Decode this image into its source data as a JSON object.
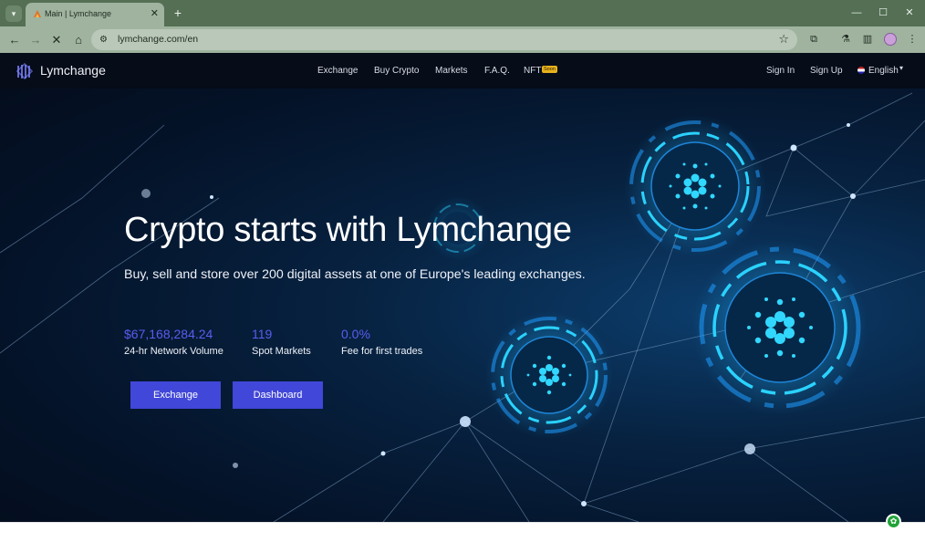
{
  "browser": {
    "tab_title": "Main | Lymchange",
    "url": "lymchange.com/en"
  },
  "site": {
    "brand": "Lymchange",
    "nav": [
      "Exchange",
      "Buy Crypto",
      "Markets",
      "F.A.Q.",
      "NFT"
    ],
    "nft_badge": "Soon",
    "sign_in": "Sign In",
    "sign_up": "Sign Up",
    "language": "English"
  },
  "hero": {
    "title": "Crypto starts with Lymchange",
    "subtitle": "Buy, sell and store over 200 digital assets at one of Europe's leading exchanges.",
    "stats": [
      {
        "value": "$67,168,284.24",
        "label": "24-hr Network Volume"
      },
      {
        "value": "119",
        "label": "Spot Markets"
      },
      {
        "value": "0.0%",
        "label": "Fee for first trades"
      }
    ],
    "buttons": {
      "exchange": "Exchange",
      "dashboard": "Dashboard"
    }
  },
  "icons": {
    "tab_search": "chevron-down-icon",
    "reload": "stop-loading-icon",
    "status": "leaf-icon"
  },
  "colors": {
    "accent": "#4147d8",
    "stat_value": "#5a5cf0",
    "nav_bg": "#060c18",
    "chrome": "#546f54",
    "nft_badge": "#e8b21c"
  }
}
